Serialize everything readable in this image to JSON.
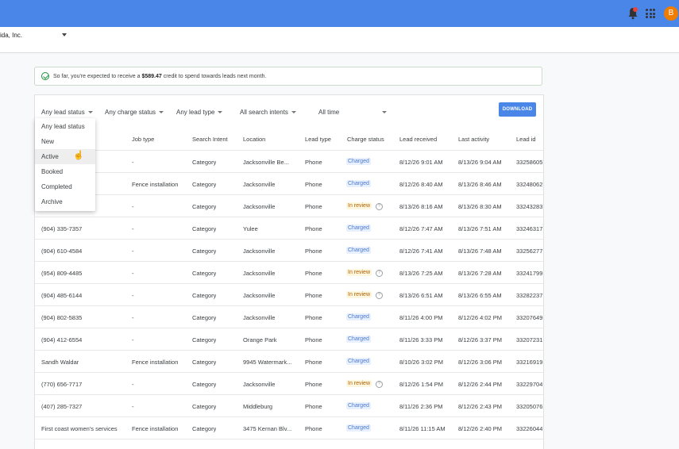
{
  "header": {
    "avatar_letter": "B",
    "account_name": "ida, Inc."
  },
  "notice": {
    "prefix": "So far, you're expected to receive a ",
    "amount": "$589.47",
    "suffix": " credit to spend towards leads next month."
  },
  "filters": [
    "Any lead status",
    "Any charge status",
    "Any lead type",
    "All search intents",
    "All time"
  ],
  "download_label": "DOWNLOAD",
  "dropdown": {
    "items": [
      "Any lead status",
      "New",
      "Active",
      "Booked",
      "Completed",
      "Archive"
    ],
    "hovered": "Active"
  },
  "columns": [
    "Job type",
    "Search Intent",
    "Location",
    "Lead type",
    "Charge status",
    "Lead received",
    "Last activity",
    "Lead id"
  ],
  "rows": [
    {
      "contact": "",
      "job": "-",
      "intent": "Category",
      "location": "Jacksonville Be...",
      "type": "Phone",
      "charge": "Charged",
      "received": "8/12/26 9:01 AM",
      "activity": "8/13/26 9:04 AM",
      "id": "33258605"
    },
    {
      "contact": "",
      "job": "Fence installation",
      "intent": "Category",
      "location": "Jacksonville",
      "type": "Phone",
      "charge": "Charged",
      "received": "8/12/26 8:40 AM",
      "activity": "8/13/26 8:46 AM",
      "id": "33248062"
    },
    {
      "contact": "",
      "job": "-",
      "intent": "Category",
      "location": "Jacksonville",
      "type": "Phone",
      "charge": "In review",
      "received": "8/13/26 8:16 AM",
      "activity": "8/13/26 8:30 AM",
      "id": "33243283"
    },
    {
      "contact": "(904) 335-7357",
      "job": "-",
      "intent": "Category",
      "location": "Yulee",
      "type": "Phone",
      "charge": "Charged",
      "received": "8/12/26 7:47 AM",
      "activity": "8/13/26 7:51 AM",
      "id": "33246317"
    },
    {
      "contact": "(904) 610-4584",
      "job": "-",
      "intent": "Category",
      "location": "Jacksonville",
      "type": "Phone",
      "charge": "Charged",
      "received": "8/12/26 7:41 AM",
      "activity": "8/13/26 7:48 AM",
      "id": "33256277"
    },
    {
      "contact": "(954) 809-4485",
      "job": "-",
      "intent": "Category",
      "location": "Jacksonville",
      "type": "Phone",
      "charge": "In review",
      "received": "8/13/26 7:25 AM",
      "activity": "8/13/26 7:28 AM",
      "id": "33241799"
    },
    {
      "contact": "(904) 485-6144",
      "job": "-",
      "intent": "Category",
      "location": "Jacksonville",
      "type": "Phone",
      "charge": "In review",
      "received": "8/13/26 6:51 AM",
      "activity": "8/13/26 6:55 AM",
      "id": "33282237"
    },
    {
      "contact": "(904) 802-5835",
      "job": "-",
      "intent": "Category",
      "location": "Jacksonville",
      "type": "Phone",
      "charge": "Charged",
      "received": "8/11/26 4:00 PM",
      "activity": "8/12/26 4:02 PM",
      "id": "33207649"
    },
    {
      "contact": "(904) 412-6554",
      "job": "-",
      "intent": "Category",
      "location": "Orange Park",
      "type": "Phone",
      "charge": "Charged",
      "received": "8/11/26 3:33 PM",
      "activity": "8/12/26 3:37 PM",
      "id": "33207231"
    },
    {
      "contact": "Sandh Waldar",
      "job": "Fence installation",
      "intent": "Category",
      "location": "9945 Watermark...",
      "type": "Phone",
      "charge": "Charged",
      "received": "8/10/26 3:02 PM",
      "activity": "8/12/26 3:06 PM",
      "id": "33216919"
    },
    {
      "contact": "(770) 656-7717",
      "job": "-",
      "intent": "Category",
      "location": "Jacksonville",
      "type": "Phone",
      "charge": "In review",
      "received": "8/12/26 1:54 PM",
      "activity": "8/12/26 2:44 PM",
      "id": "33229704"
    },
    {
      "contact": "(407) 285-7327",
      "job": "-",
      "intent": "Category",
      "location": "Middleburg",
      "type": "Phone",
      "charge": "Charged",
      "received": "8/11/26 2:36 PM",
      "activity": "8/12/26 2:43 PM",
      "id": "33205076"
    },
    {
      "contact": "First coast women's services",
      "job": "Fence installation",
      "intent": "Category",
      "location": "3475 Kernan Blv...",
      "type": "Phone",
      "charge": "Charged",
      "received": "8/11/26 11:15 AM",
      "activity": "8/12/26 2:40 PM",
      "id": "33226044"
    }
  ]
}
